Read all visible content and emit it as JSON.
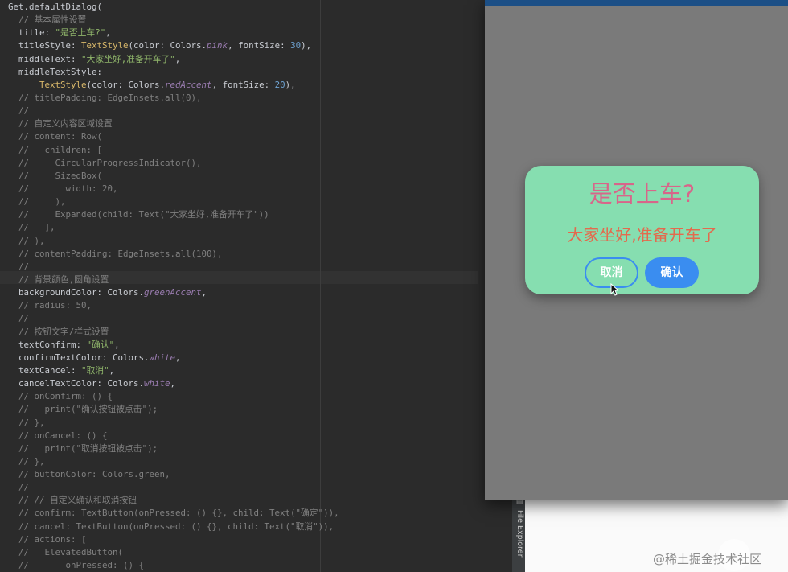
{
  "editor": {
    "code_lines": [
      [
        {
          "t": "Get.defaultDialog(",
          "c": ""
        }
      ],
      [
        {
          "t": "  // 基本属性设置",
          "c": "cm"
        }
      ],
      [
        {
          "t": "  title: ",
          "c": ""
        },
        {
          "t": "\"是否上车?\"",
          "c": "st"
        },
        {
          "t": ",",
          "c": ""
        }
      ],
      [
        {
          "t": "  titleStyle: ",
          "c": ""
        },
        {
          "t": "TextStyle",
          "c": "ty"
        },
        {
          "t": "(color: Colors.",
          "c": ""
        },
        {
          "t": "pink",
          "c": "it"
        },
        {
          "t": ", fontSize: ",
          "c": ""
        },
        {
          "t": "30",
          "c": "nu"
        },
        {
          "t": "),",
          "c": ""
        }
      ],
      [
        {
          "t": "  middleText: ",
          "c": ""
        },
        {
          "t": "\"大家坐好,准备开车了\"",
          "c": "st"
        },
        {
          "t": ",",
          "c": ""
        }
      ],
      [
        {
          "t": "  middleTextStyle:",
          "c": ""
        }
      ],
      [
        {
          "t": "      ",
          "c": ""
        },
        {
          "t": "TextStyle",
          "c": "ty"
        },
        {
          "t": "(color: Colors.",
          "c": ""
        },
        {
          "t": "redAccent",
          "c": "it"
        },
        {
          "t": ", fontSize: ",
          "c": ""
        },
        {
          "t": "20",
          "c": "nu"
        },
        {
          "t": "),",
          "c": ""
        }
      ],
      [
        {
          "t": "  // titlePadding: EdgeInsets.all(0),",
          "c": "cm"
        }
      ],
      [
        {
          "t": "  //",
          "c": "cm"
        }
      ],
      [
        {
          "t": "  // 自定义内容区域设置",
          "c": "cm"
        }
      ],
      [
        {
          "t": "  // content: Row(",
          "c": "cm"
        }
      ],
      [
        {
          "t": "  //   children: [",
          "c": "cm"
        }
      ],
      [
        {
          "t": "  //     CircularProgressIndicator(),",
          "c": "cm"
        }
      ],
      [
        {
          "t": "  //     SizedBox(",
          "c": "cm"
        }
      ],
      [
        {
          "t": "  //       width: 20,",
          "c": "cm"
        }
      ],
      [
        {
          "t": "  //     ),",
          "c": "cm"
        }
      ],
      [
        {
          "t": "  //     Expanded(child: Text(\"大家坐好,准备开车了\"))",
          "c": "cm"
        }
      ],
      [
        {
          "t": "  //   ],",
          "c": "cm"
        }
      ],
      [
        {
          "t": "  // ),",
          "c": "cm"
        }
      ],
      [
        {
          "t": "  // contentPadding: EdgeInsets.all(100),",
          "c": "cm"
        }
      ],
      [
        {
          "t": "  //",
          "c": "cm"
        }
      ],
      [
        {
          "t": "  // 背景颜色,圆角设置",
          "c": "cm"
        }
      ],
      [
        {
          "t": "  backgroundColor: Colors.",
          "c": ""
        },
        {
          "t": "greenAccent",
          "c": "it"
        },
        {
          "t": ",",
          "c": ""
        }
      ],
      [
        {
          "t": "  // radius: 50,",
          "c": "cm"
        }
      ],
      [
        {
          "t": "  //",
          "c": "cm"
        }
      ],
      [
        {
          "t": "  // 按钮文字/样式设置",
          "c": "cm"
        }
      ],
      [
        {
          "t": "  textConfirm: ",
          "c": ""
        },
        {
          "t": "\"确认\"",
          "c": "st"
        },
        {
          "t": ",",
          "c": ""
        }
      ],
      [
        {
          "t": "  confirmTextColor: Colors.",
          "c": ""
        },
        {
          "t": "white",
          "c": "it"
        },
        {
          "t": ",",
          "c": ""
        }
      ],
      [
        {
          "t": "  textCancel: ",
          "c": ""
        },
        {
          "t": "\"取消\"",
          "c": "st"
        },
        {
          "t": ",",
          "c": ""
        }
      ],
      [
        {
          "t": "  cancelTextColor: Colors.",
          "c": ""
        },
        {
          "t": "white",
          "c": "it"
        },
        {
          "t": ",",
          "c": ""
        }
      ],
      [
        {
          "t": "  // onConfirm: () {",
          "c": "cm"
        }
      ],
      [
        {
          "t": "  //   print(\"确认按钮被点击\");",
          "c": "cm"
        }
      ],
      [
        {
          "t": "  // },",
          "c": "cm"
        }
      ],
      [
        {
          "t": "  // onCancel: () {",
          "c": "cm"
        }
      ],
      [
        {
          "t": "  //   print(\"取消按钮被点击\");",
          "c": "cm"
        }
      ],
      [
        {
          "t": "  // },",
          "c": "cm"
        }
      ],
      [
        {
          "t": "  // buttonColor: Colors.green,",
          "c": "cm"
        }
      ],
      [
        {
          "t": "  //",
          "c": "cm"
        }
      ],
      [
        {
          "t": "  // // 自定义确认和取消按钮",
          "c": "cm"
        }
      ],
      [
        {
          "t": "  // confirm: TextButton(onPressed: () {}, child: Text(\"确定\")),",
          "c": "cm"
        }
      ],
      [
        {
          "t": "  // cancel: TextButton(onPressed: () {}, child: Text(\"取消\")),",
          "c": "cm"
        }
      ],
      [
        {
          "t": "  // actions: [",
          "c": "cm"
        }
      ],
      [
        {
          "t": "  //   ElevatedButton(",
          "c": "cm"
        }
      ],
      [
        {
          "t": "  //       onPressed: () {",
          "c": "cm"
        }
      ]
    ]
  },
  "toolstrip": {
    "label": "File Explorer",
    "icon": "document-icon"
  },
  "dialog": {
    "title": "是否上车?",
    "middle_text": "大家坐好,准备开车了",
    "cancel_label": "取消",
    "confirm_label": "确认"
  },
  "watermark": "@稀土掘金技术社区",
  "colors": {
    "editor_bg": "#2b2b2b",
    "dialog_bg": "#86deb0",
    "title_color": "#d8658a",
    "middle_color": "#e36a4d",
    "button_color": "#3a8df0",
    "phone_scrim": "#7a7a7a",
    "statusbar": "#1c4f86"
  }
}
